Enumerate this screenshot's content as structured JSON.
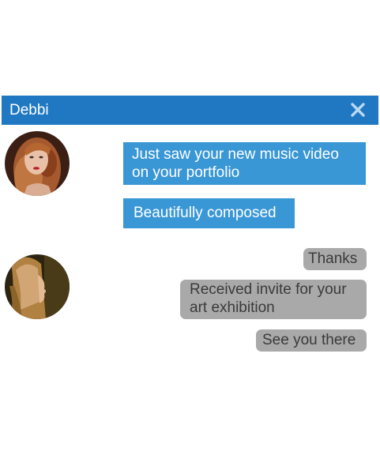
{
  "header": {
    "title": "Debbi",
    "close_icon": "close-x-icon",
    "background_color": "#1f78c1"
  },
  "conversation": {
    "incoming_color": "#3a97d6",
    "outgoing_color": "#a9a9a9",
    "messages": [
      {
        "sender": "incoming",
        "text": "Just saw your new music video on your portfolio"
      },
      {
        "sender": "incoming",
        "text": "Beautifully composed"
      },
      {
        "sender": "outgoing",
        "text": "Thanks"
      },
      {
        "sender": "outgoing",
        "text": "Received invite for your art exhibition"
      },
      {
        "sender": "outgoing",
        "text": "See you there"
      }
    ]
  },
  "avatars": [
    {
      "icon": "red-haired-woman-avatar"
    },
    {
      "icon": "long-haired-woman-profile-avatar"
    }
  ]
}
